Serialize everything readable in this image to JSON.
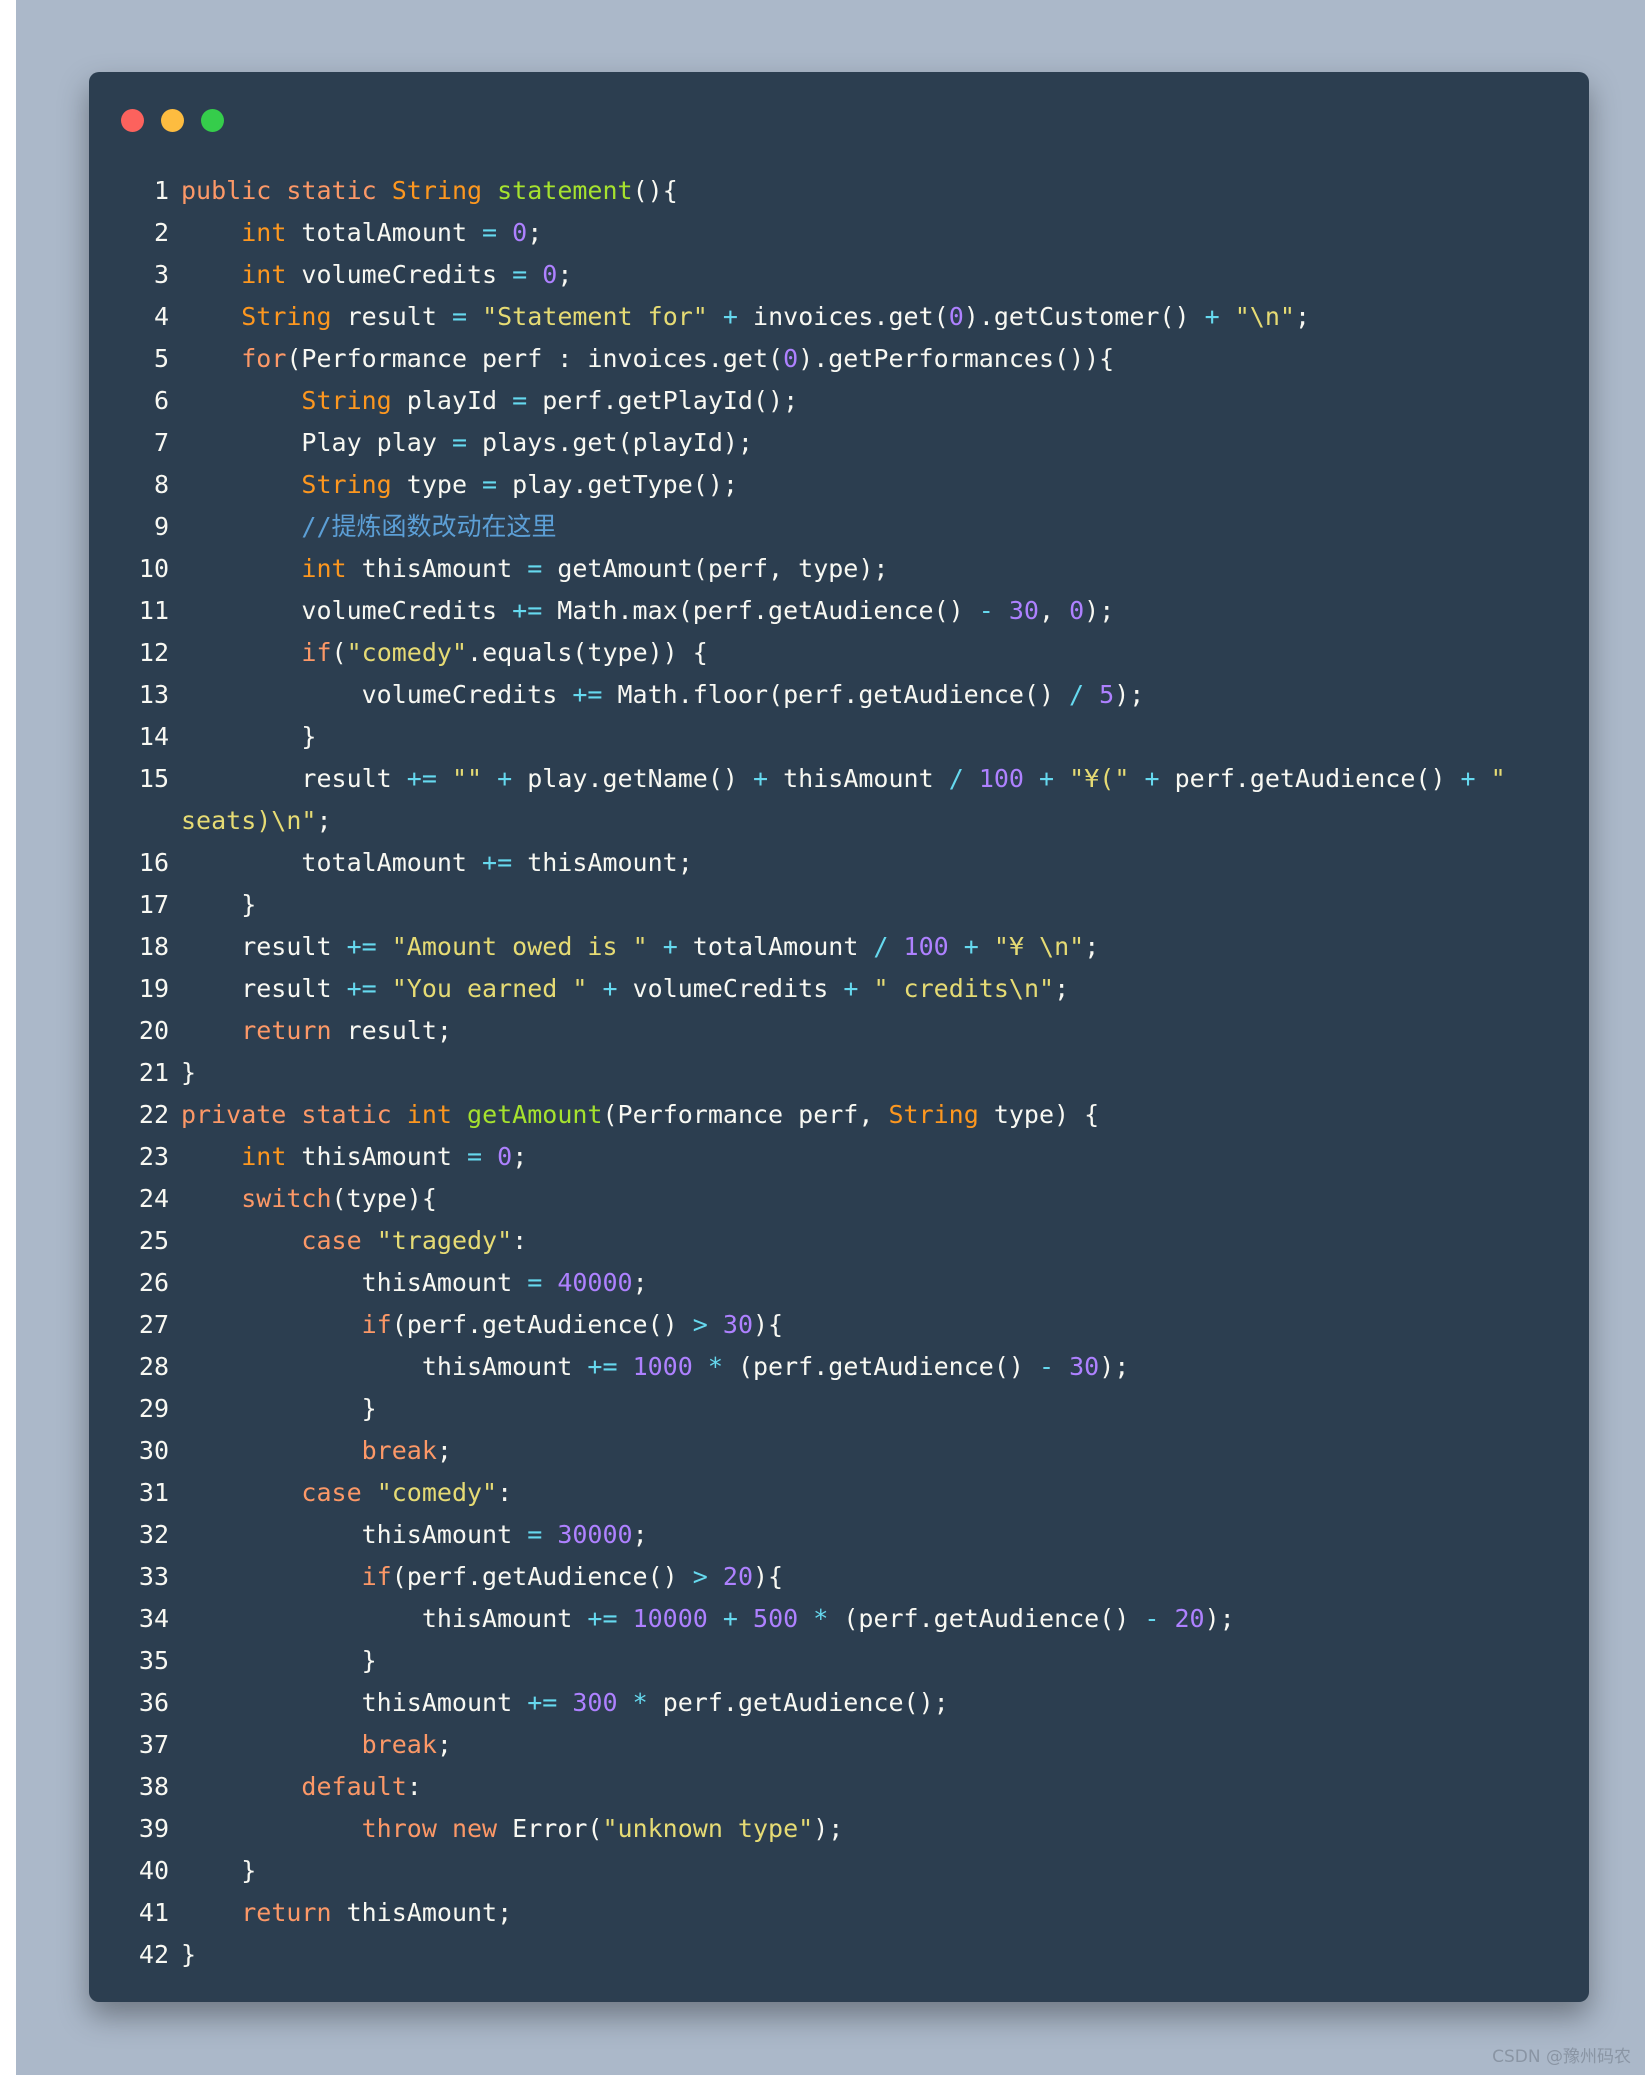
{
  "window": {
    "buttons": [
      "close",
      "minimize",
      "maximize"
    ],
    "colors": {
      "close": "#fc625d",
      "minimize": "#fdbc40",
      "maximize": "#35cd4b"
    }
  },
  "code": {
    "language": "java",
    "lines": [
      {
        "n": "1",
        "tokens": [
          [
            "kw",
            "public"
          ],
          [
            "pl",
            " "
          ],
          [
            "kw",
            "static"
          ],
          [
            "pl",
            " "
          ],
          [
            "type",
            "String"
          ],
          [
            "pl",
            " "
          ],
          [
            "fn",
            "statement"
          ],
          [
            "pl",
            "(){"
          ]
        ]
      },
      {
        "n": "2",
        "tokens": [
          [
            "pl",
            "    "
          ],
          [
            "type",
            "int"
          ],
          [
            "pl",
            " totalAmount "
          ],
          [
            "op",
            "="
          ],
          [
            "pl",
            " "
          ],
          [
            "num",
            "0"
          ],
          [
            "pl",
            ";"
          ]
        ]
      },
      {
        "n": "3",
        "tokens": [
          [
            "pl",
            "    "
          ],
          [
            "type",
            "int"
          ],
          [
            "pl",
            " volumeCredits "
          ],
          [
            "op",
            "="
          ],
          [
            "pl",
            " "
          ],
          [
            "num",
            "0"
          ],
          [
            "pl",
            ";"
          ]
        ]
      },
      {
        "n": "4",
        "tokens": [
          [
            "pl",
            "    "
          ],
          [
            "type",
            "String"
          ],
          [
            "pl",
            " result "
          ],
          [
            "op",
            "="
          ],
          [
            "pl",
            " "
          ],
          [
            "str",
            "\"Statement for\""
          ],
          [
            "pl",
            " "
          ],
          [
            "op",
            "+"
          ],
          [
            "pl",
            " invoices.get("
          ],
          [
            "num",
            "0"
          ],
          [
            "pl",
            ").getCustomer() "
          ],
          [
            "op",
            "+"
          ],
          [
            "pl",
            " "
          ],
          [
            "str",
            "\"\\n\""
          ],
          [
            "pl",
            ";"
          ]
        ]
      },
      {
        "n": "5",
        "tokens": [
          [
            "pl",
            "    "
          ],
          [
            "kw",
            "for"
          ],
          [
            "pl",
            "(Performance perf : invoices.get("
          ],
          [
            "num",
            "0"
          ],
          [
            "pl",
            ").getPerformances()){"
          ]
        ]
      },
      {
        "n": "6",
        "tokens": [
          [
            "pl",
            "        "
          ],
          [
            "type",
            "String"
          ],
          [
            "pl",
            " playId "
          ],
          [
            "op",
            "="
          ],
          [
            "pl",
            " perf.getPlayId();"
          ]
        ]
      },
      {
        "n": "7",
        "tokens": [
          [
            "pl",
            "        Play play "
          ],
          [
            "op",
            "="
          ],
          [
            "pl",
            " plays.get(playId);"
          ]
        ]
      },
      {
        "n": "8",
        "tokens": [
          [
            "pl",
            "        "
          ],
          [
            "type",
            "String"
          ],
          [
            "pl",
            " type "
          ],
          [
            "op",
            "="
          ],
          [
            "pl",
            " play.getType();"
          ]
        ]
      },
      {
        "n": "9",
        "tokens": [
          [
            "pl",
            "        "
          ],
          [
            "cmt",
            "//提炼函数改动在这里"
          ]
        ]
      },
      {
        "n": "10",
        "tokens": [
          [
            "pl",
            "        "
          ],
          [
            "type",
            "int"
          ],
          [
            "pl",
            " thisAmount "
          ],
          [
            "op",
            "="
          ],
          [
            "pl",
            " getAmount(perf, type);"
          ]
        ]
      },
      {
        "n": "11",
        "tokens": [
          [
            "pl",
            "        volumeCredits "
          ],
          [
            "op",
            "+="
          ],
          [
            "pl",
            " Math.max(perf.getAudience() "
          ],
          [
            "op",
            "-"
          ],
          [
            "pl",
            " "
          ],
          [
            "num",
            "30"
          ],
          [
            "pl",
            ", "
          ],
          [
            "num",
            "0"
          ],
          [
            "pl",
            ");"
          ]
        ]
      },
      {
        "n": "12",
        "tokens": [
          [
            "pl",
            "        "
          ],
          [
            "kw",
            "if"
          ],
          [
            "pl",
            "("
          ],
          [
            "str",
            "\"comedy\""
          ],
          [
            "pl",
            ".equals(type)) {"
          ]
        ]
      },
      {
        "n": "13",
        "tokens": [
          [
            "pl",
            "            volumeCredits "
          ],
          [
            "op",
            "+="
          ],
          [
            "pl",
            " Math.floor(perf.getAudience() "
          ],
          [
            "op",
            "/"
          ],
          [
            "pl",
            " "
          ],
          [
            "num",
            "5"
          ],
          [
            "pl",
            ");"
          ]
        ]
      },
      {
        "n": "14",
        "tokens": [
          [
            "pl",
            "        }"
          ]
        ]
      },
      {
        "n": "15",
        "tokens": [
          [
            "pl",
            "        result "
          ],
          [
            "op",
            "+="
          ],
          [
            "pl",
            " "
          ],
          [
            "str",
            "\"\""
          ],
          [
            "pl",
            " "
          ],
          [
            "op",
            "+"
          ],
          [
            "pl",
            " play.getName() "
          ],
          [
            "op",
            "+"
          ],
          [
            "pl",
            " thisAmount "
          ],
          [
            "op",
            "/"
          ],
          [
            "pl",
            " "
          ],
          [
            "num",
            "100"
          ],
          [
            "pl",
            " "
          ],
          [
            "op",
            "+"
          ],
          [
            "pl",
            " "
          ],
          [
            "str",
            "\"¥(\""
          ],
          [
            "pl",
            " "
          ],
          [
            "op",
            "+"
          ],
          [
            "pl",
            " perf.getAudience() "
          ],
          [
            "op",
            "+"
          ],
          [
            "pl",
            " "
          ],
          [
            "str",
            "\""
          ]
        ]
      },
      {
        "n": "",
        "tokens": [
          [
            "str",
            "seats)\\n\""
          ],
          [
            "pl",
            ";"
          ]
        ]
      },
      {
        "n": "16",
        "tokens": [
          [
            "pl",
            "        totalAmount "
          ],
          [
            "op",
            "+="
          ],
          [
            "pl",
            " thisAmount;"
          ]
        ]
      },
      {
        "n": "17",
        "tokens": [
          [
            "pl",
            "    }"
          ]
        ]
      },
      {
        "n": "18",
        "tokens": [
          [
            "pl",
            "    result "
          ],
          [
            "op",
            "+="
          ],
          [
            "pl",
            " "
          ],
          [
            "str",
            "\"Amount owed is \""
          ],
          [
            "pl",
            " "
          ],
          [
            "op",
            "+"
          ],
          [
            "pl",
            " totalAmount "
          ],
          [
            "op",
            "/"
          ],
          [
            "pl",
            " "
          ],
          [
            "num",
            "100"
          ],
          [
            "pl",
            " "
          ],
          [
            "op",
            "+"
          ],
          [
            "pl",
            " "
          ],
          [
            "str",
            "\"¥ \\n\""
          ],
          [
            "pl",
            ";"
          ]
        ]
      },
      {
        "n": "19",
        "tokens": [
          [
            "pl",
            "    result "
          ],
          [
            "op",
            "+="
          ],
          [
            "pl",
            " "
          ],
          [
            "str",
            "\"You earned \""
          ],
          [
            "pl",
            " "
          ],
          [
            "op",
            "+"
          ],
          [
            "pl",
            " volumeCredits "
          ],
          [
            "op",
            "+"
          ],
          [
            "pl",
            " "
          ],
          [
            "str",
            "\" credits\\n\""
          ],
          [
            "pl",
            ";"
          ]
        ]
      },
      {
        "n": "20",
        "tokens": [
          [
            "pl",
            "    "
          ],
          [
            "kw",
            "return"
          ],
          [
            "pl",
            " result;"
          ]
        ]
      },
      {
        "n": "21",
        "tokens": [
          [
            "pl",
            "}"
          ]
        ]
      },
      {
        "n": "22",
        "tokens": [
          [
            "kw",
            "private"
          ],
          [
            "pl",
            " "
          ],
          [
            "kw",
            "static"
          ],
          [
            "pl",
            " "
          ],
          [
            "type",
            "int"
          ],
          [
            "pl",
            " "
          ],
          [
            "fn",
            "getAmount"
          ],
          [
            "pl",
            "(Performance perf, "
          ],
          [
            "type",
            "String"
          ],
          [
            "pl",
            " type) {"
          ]
        ]
      },
      {
        "n": "23",
        "tokens": [
          [
            "pl",
            "    "
          ],
          [
            "type",
            "int"
          ],
          [
            "pl",
            " thisAmount "
          ],
          [
            "op",
            "="
          ],
          [
            "pl",
            " "
          ],
          [
            "num",
            "0"
          ],
          [
            "pl",
            ";"
          ]
        ]
      },
      {
        "n": "24",
        "tokens": [
          [
            "pl",
            "    "
          ],
          [
            "kw",
            "switch"
          ],
          [
            "pl",
            "(type){"
          ]
        ]
      },
      {
        "n": "25",
        "tokens": [
          [
            "pl",
            "        "
          ],
          [
            "kw",
            "case"
          ],
          [
            "pl",
            " "
          ],
          [
            "str",
            "\"tragedy\""
          ],
          [
            "pl",
            ":"
          ]
        ]
      },
      {
        "n": "26",
        "tokens": [
          [
            "pl",
            "            thisAmount "
          ],
          [
            "op",
            "="
          ],
          [
            "pl",
            " "
          ],
          [
            "num",
            "40000"
          ],
          [
            "pl",
            ";"
          ]
        ]
      },
      {
        "n": "27",
        "tokens": [
          [
            "pl",
            "            "
          ],
          [
            "kw",
            "if"
          ],
          [
            "pl",
            "(perf.getAudience() "
          ],
          [
            "op",
            ">"
          ],
          [
            "pl",
            " "
          ],
          [
            "num",
            "30"
          ],
          [
            "pl",
            "){"
          ]
        ]
      },
      {
        "n": "28",
        "tokens": [
          [
            "pl",
            "                thisAmount "
          ],
          [
            "op",
            "+="
          ],
          [
            "pl",
            " "
          ],
          [
            "num",
            "1000"
          ],
          [
            "pl",
            " "
          ],
          [
            "op",
            "*"
          ],
          [
            "pl",
            " (perf.getAudience() "
          ],
          [
            "op",
            "-"
          ],
          [
            "pl",
            " "
          ],
          [
            "num",
            "30"
          ],
          [
            "pl",
            ");"
          ]
        ]
      },
      {
        "n": "29",
        "tokens": [
          [
            "pl",
            "            }"
          ]
        ]
      },
      {
        "n": "30",
        "tokens": [
          [
            "pl",
            "            "
          ],
          [
            "kw",
            "break"
          ],
          [
            "pl",
            ";"
          ]
        ]
      },
      {
        "n": "31",
        "tokens": [
          [
            "pl",
            "        "
          ],
          [
            "kw",
            "case"
          ],
          [
            "pl",
            " "
          ],
          [
            "str",
            "\"comedy\""
          ],
          [
            "pl",
            ":"
          ]
        ]
      },
      {
        "n": "32",
        "tokens": [
          [
            "pl",
            "            thisAmount "
          ],
          [
            "op",
            "="
          ],
          [
            "pl",
            " "
          ],
          [
            "num",
            "30000"
          ],
          [
            "pl",
            ";"
          ]
        ]
      },
      {
        "n": "33",
        "tokens": [
          [
            "pl",
            "            "
          ],
          [
            "kw",
            "if"
          ],
          [
            "pl",
            "(perf.getAudience() "
          ],
          [
            "op",
            ">"
          ],
          [
            "pl",
            " "
          ],
          [
            "num",
            "20"
          ],
          [
            "pl",
            "){"
          ]
        ]
      },
      {
        "n": "34",
        "tokens": [
          [
            "pl",
            "                thisAmount "
          ],
          [
            "op",
            "+="
          ],
          [
            "pl",
            " "
          ],
          [
            "num",
            "10000"
          ],
          [
            "pl",
            " "
          ],
          [
            "op",
            "+"
          ],
          [
            "pl",
            " "
          ],
          [
            "num",
            "500"
          ],
          [
            "pl",
            " "
          ],
          [
            "op",
            "*"
          ],
          [
            "pl",
            " (perf.getAudience() "
          ],
          [
            "op",
            "-"
          ],
          [
            "pl",
            " "
          ],
          [
            "num",
            "20"
          ],
          [
            "pl",
            ");"
          ]
        ]
      },
      {
        "n": "35",
        "tokens": [
          [
            "pl",
            "            }"
          ]
        ]
      },
      {
        "n": "36",
        "tokens": [
          [
            "pl",
            "            thisAmount "
          ],
          [
            "op",
            "+="
          ],
          [
            "pl",
            " "
          ],
          [
            "num",
            "300"
          ],
          [
            "pl",
            " "
          ],
          [
            "op",
            "*"
          ],
          [
            "pl",
            " perf.getAudience();"
          ]
        ]
      },
      {
        "n": "37",
        "tokens": [
          [
            "pl",
            "            "
          ],
          [
            "kw",
            "break"
          ],
          [
            "pl",
            ";"
          ]
        ]
      },
      {
        "n": "38",
        "tokens": [
          [
            "pl",
            "        "
          ],
          [
            "kw",
            "default"
          ],
          [
            "pl",
            ":"
          ]
        ]
      },
      {
        "n": "39",
        "tokens": [
          [
            "pl",
            "            "
          ],
          [
            "kw",
            "throw"
          ],
          [
            "pl",
            " "
          ],
          [
            "kw",
            "new"
          ],
          [
            "pl",
            " Error("
          ],
          [
            "str",
            "\"unknown type\""
          ],
          [
            "pl",
            ");"
          ]
        ]
      },
      {
        "n": "40",
        "tokens": [
          [
            "pl",
            "    }"
          ]
        ]
      },
      {
        "n": "41",
        "tokens": [
          [
            "pl",
            "    "
          ],
          [
            "kw",
            "return"
          ],
          [
            "pl",
            " thisAmount;"
          ]
        ]
      },
      {
        "n": "42",
        "tokens": [
          [
            "pl",
            "}"
          ]
        ]
      }
    ]
  },
  "watermark": "CSDN @豫州码农"
}
